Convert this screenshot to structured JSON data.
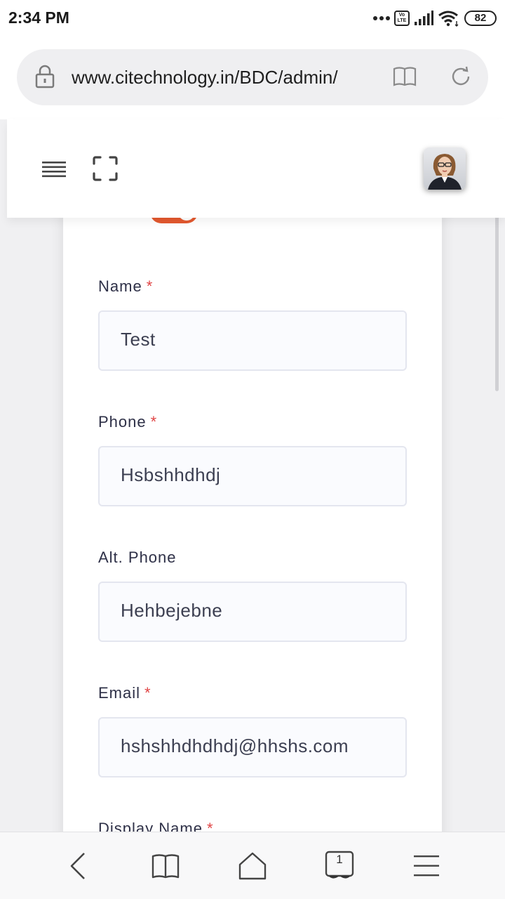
{
  "status_bar": {
    "time": "2:34 PM",
    "network_badge_top": "Vo",
    "network_badge_bottom": "LTE",
    "battery": "82"
  },
  "browser": {
    "url": "www.citechnology.in/BDC/admin/"
  },
  "header": {
    "menu_icon": "menu-icon",
    "expand_icon": "fullscreen-icon",
    "avatar": "user-avatar"
  },
  "form": {
    "fields": [
      {
        "label": "Name",
        "required": "*",
        "value": "Test"
      },
      {
        "label": "Phone",
        "required": "*",
        "value": "Hsbshhdhdj"
      },
      {
        "label": "Alt. Phone",
        "required": "",
        "value": "Hehbejebne"
      },
      {
        "label": "Email",
        "required": "*",
        "value": "hshshhdhdhdj@hhshs.com"
      },
      {
        "label": "Display Name",
        "required": "*"
      }
    ]
  },
  "bottom_nav": {
    "tab_count": "1",
    "icons": [
      "back-icon",
      "bookmarks-icon",
      "home-icon",
      "tabs-icon",
      "menu-icon"
    ]
  },
  "colors": {
    "accent": "#e4592f",
    "required": "#e04545",
    "label": "#2e3047"
  }
}
